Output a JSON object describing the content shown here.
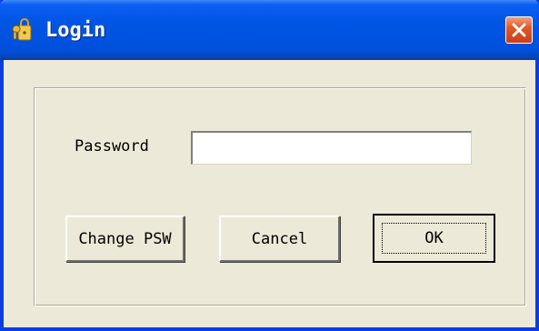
{
  "window": {
    "title": "Login",
    "icon": "keys-icon",
    "close_icon": "close-icon"
  },
  "form": {
    "password_label": "Password",
    "password_value": ""
  },
  "buttons": {
    "change_psw": "Change PSW",
    "cancel": "Cancel",
    "ok": "OK"
  },
  "colors": {
    "titlebar": "#0054e3",
    "dialog_bg": "#ece9d8",
    "close_button": "#e2592a"
  }
}
